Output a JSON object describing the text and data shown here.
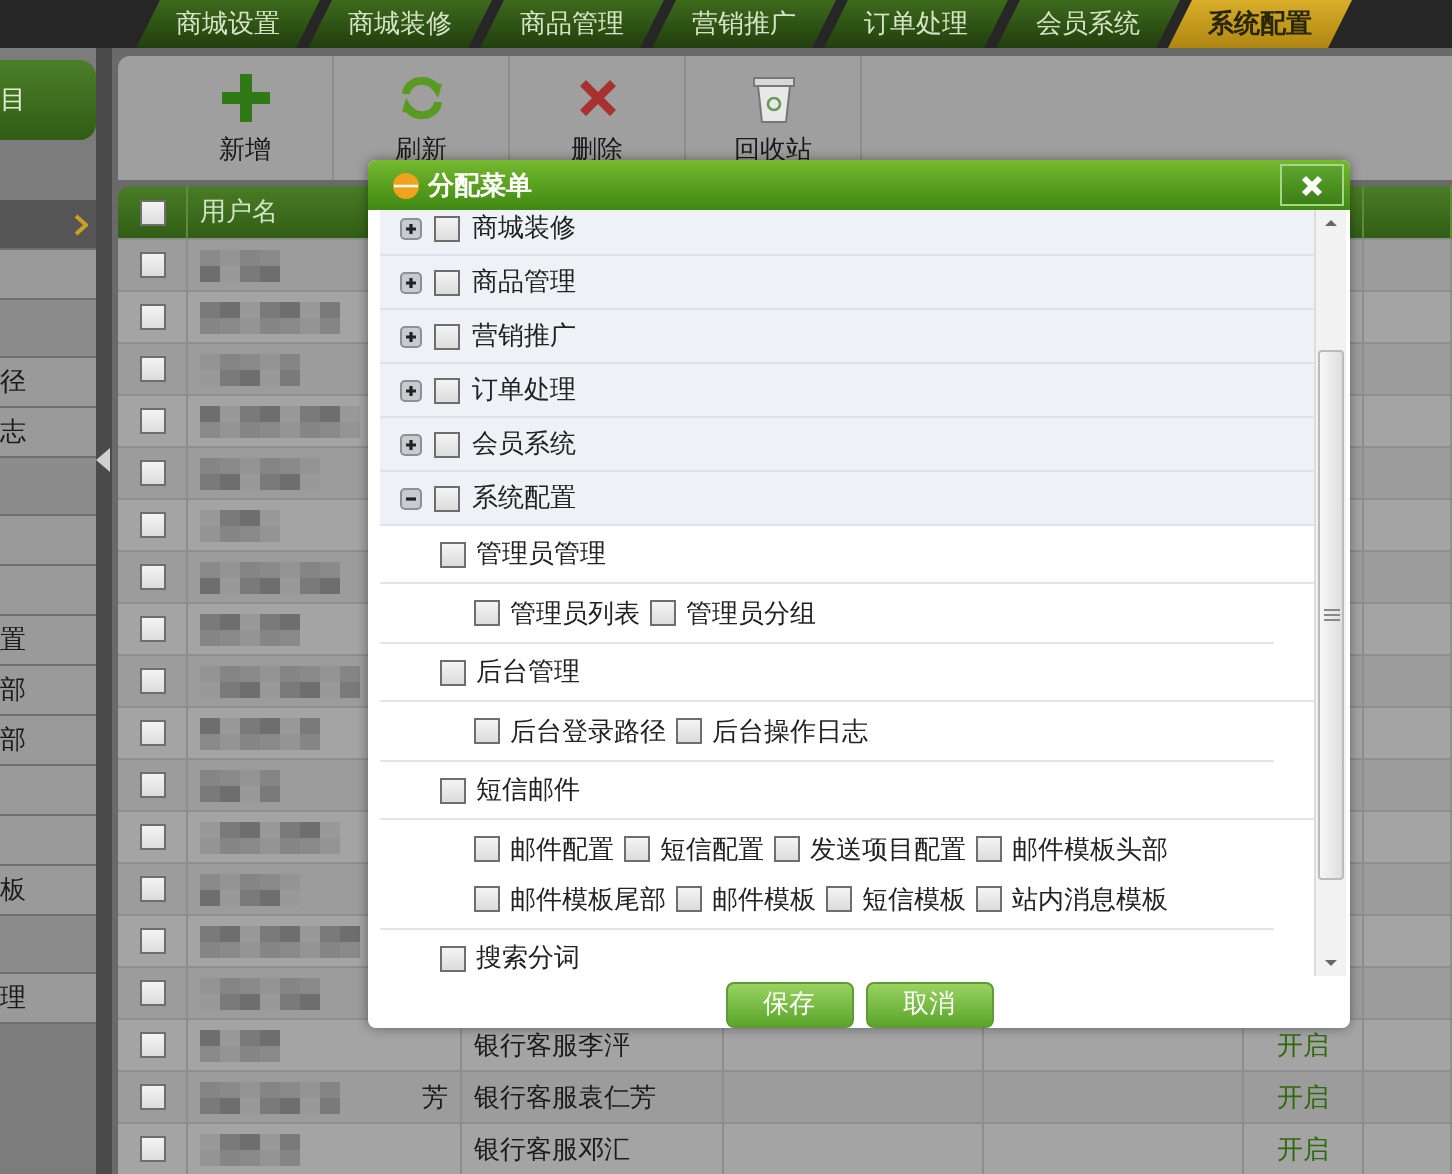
{
  "top_nav": {
    "tabs": [
      {
        "label": "商城设置",
        "selected": false
      },
      {
        "label": "商城装修",
        "selected": false
      },
      {
        "label": "商品管理",
        "selected": false
      },
      {
        "label": "营销推广",
        "selected": false
      },
      {
        "label": "订单处理",
        "selected": false
      },
      {
        "label": "会员系统",
        "selected": false
      },
      {
        "label": "系统配置",
        "selected": true
      }
    ]
  },
  "sidebar": {
    "header": "目",
    "items": [
      {
        "kind": "item",
        "selected": true
      },
      {
        "kind": "item",
        "selected": false
      },
      {
        "kind": "group",
        "selected": false
      },
      {
        "kind": "item",
        "label": "径",
        "selected": false
      },
      {
        "kind": "item",
        "label": "志",
        "selected": false
      },
      {
        "kind": "group",
        "selected": false
      },
      {
        "kind": "item",
        "selected": false
      },
      {
        "kind": "item",
        "selected": false
      },
      {
        "kind": "item",
        "label": "置",
        "selected": false
      },
      {
        "kind": "item",
        "label": "部",
        "selected": false
      },
      {
        "kind": "item",
        "label": "部",
        "selected": false
      },
      {
        "kind": "item",
        "selected": false
      },
      {
        "kind": "item",
        "selected": false
      },
      {
        "kind": "item",
        "label": "板",
        "selected": false
      },
      {
        "kind": "group",
        "selected": false
      },
      {
        "kind": "item",
        "label": "理",
        "selected": false
      }
    ]
  },
  "toolbar": {
    "buttons": [
      {
        "label": "新增",
        "kind": "add"
      },
      {
        "label": "刷新",
        "kind": "refresh"
      },
      {
        "label": "删除",
        "kind": "delete"
      },
      {
        "label": "回收站",
        "kind": "recycle"
      }
    ]
  },
  "table": {
    "header_checked": false,
    "columns": [
      "用户名"
    ],
    "rows": [
      {
        "checked": false
      },
      {
        "checked": false
      },
      {
        "checked": false
      },
      {
        "checked": false
      },
      {
        "checked": false
      },
      {
        "checked": false
      },
      {
        "checked": false
      },
      {
        "checked": false
      },
      {
        "checked": false
      },
      {
        "checked": false
      },
      {
        "checked": false
      },
      {
        "checked": false
      },
      {
        "checked": false
      },
      {
        "checked": false
      },
      {
        "checked": false
      },
      {
        "checked": false,
        "column_3": "银行客服李泙",
        "column_6": "开启"
      },
      {
        "checked": false,
        "user_name": "芳",
        "column_3": "银行客服袁仁芳",
        "column_6": "开启"
      },
      {
        "checked": false,
        "column_3": "银行客服邓汇",
        "column_6": "开启"
      }
    ]
  },
  "dialog": {
    "title": "分配菜单",
    "menu_tree": [
      {
        "label": "商城装修",
        "checked": false,
        "expanded": false
      },
      {
        "label": "商品管理",
        "checked": false,
        "expanded": false
      },
      {
        "label": "营销推广",
        "checked": false,
        "expanded": false
      },
      {
        "label": "订单处理",
        "checked": false,
        "expanded": false
      },
      {
        "label": "会员系统",
        "checked": false,
        "expanded": false
      },
      {
        "label": "系统配置",
        "checked": false,
        "expanded": true,
        "children": [
          {
            "label": "管理员管理",
            "checked": false,
            "children": [
              {
                "label": "管理员列表",
                "checked": false
              },
              {
                "label": "管理员分组",
                "checked": false
              }
            ]
          },
          {
            "label": "后台管理",
            "checked": false,
            "children": [
              {
                "label": "后台登录路径",
                "checked": false
              },
              {
                "label": "后台操作日志",
                "checked": false
              }
            ]
          },
          {
            "label": "短信邮件",
            "checked": false,
            "children": [
              {
                "label": "邮件配置",
                "checked": false
              },
              {
                "label": "短信配置",
                "checked": false
              },
              {
                "label": "发送项目配置",
                "checked": false
              },
              {
                "label": "邮件模板头部",
                "checked": false
              },
              {
                "label": "邮件模板尾部",
                "checked": false
              },
              {
                "label": "邮件模板",
                "checked": false
              },
              {
                "label": "短信模板",
                "checked": false
              },
              {
                "label": "站内消息模板",
                "checked": false
              }
            ]
          },
          {
            "label": "搜索分词",
            "checked": false
          }
        ]
      }
    ],
    "buttons": [
      "保存",
      "取消"
    ]
  }
}
